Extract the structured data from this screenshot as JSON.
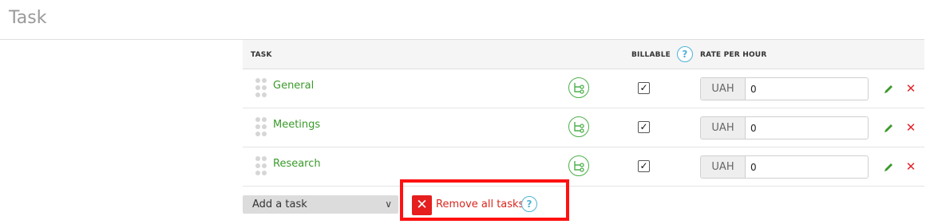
{
  "page": {
    "title": "Task"
  },
  "table": {
    "headers": {
      "task": "TASK",
      "billable": "BILLABLE",
      "rate": "RATE PER HOUR"
    },
    "help_glyph": "?",
    "rows": [
      {
        "name": "General",
        "billable": true,
        "currency": "UAH",
        "rate": "0"
      },
      {
        "name": "Meetings",
        "billable": true,
        "currency": "UAH",
        "rate": "0"
      },
      {
        "name": "Research",
        "billable": true,
        "currency": "UAH",
        "rate": "0"
      }
    ],
    "check_glyph": "✓",
    "delete_glyph": "✕"
  },
  "footer": {
    "add_task_label": "Add a task",
    "chevron_glyph": "∨",
    "remove_all_label": "Remove all tasks",
    "remove_glyph": "✕",
    "help_glyph": "?"
  },
  "colors": {
    "accent_green": "#3a9a2a",
    "danger_red": "#e61e1e",
    "help_blue": "#4fb3d9"
  }
}
